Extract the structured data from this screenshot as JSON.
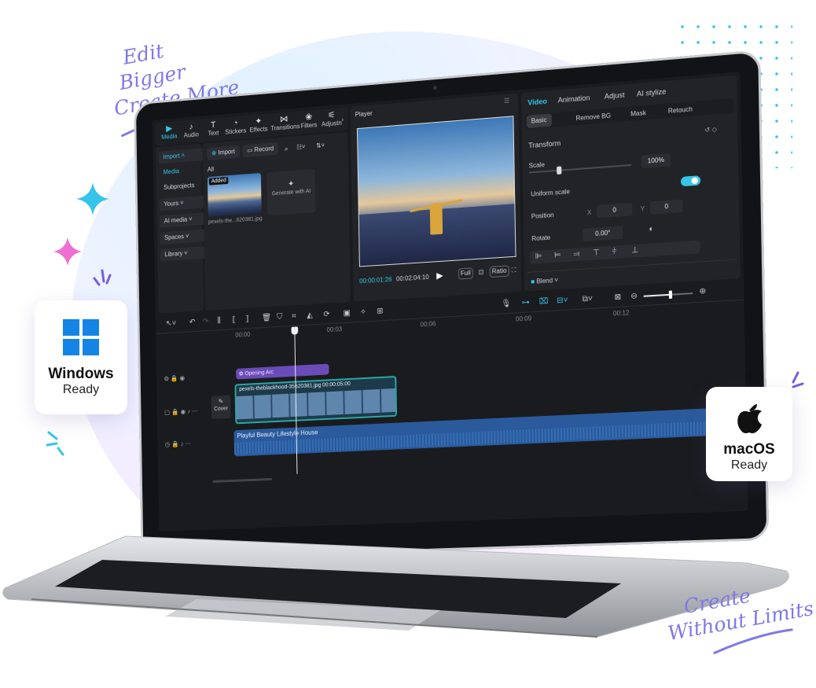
{
  "slogans": {
    "top": [
      "Edit",
      "Bigger",
      "Create More"
    ],
    "bottom": [
      "Create",
      "Without Limits"
    ]
  },
  "badges": {
    "windows": {
      "title": "Windows",
      "subtitle": "Ready"
    },
    "macos": {
      "title": "macOS",
      "subtitle": "Ready"
    }
  },
  "colors": {
    "accent": "#36c6e8",
    "slogan": "#7f78e6",
    "clip_purple": "#6b4bb8",
    "video_teal": "#2aa6a6"
  },
  "toolbar": [
    {
      "label": "Media",
      "icon": "media-icon"
    },
    {
      "label": "Audio",
      "icon": "audio-icon"
    },
    {
      "label": "Text",
      "icon": "text-icon"
    },
    {
      "label": "Stickers",
      "icon": "stickers-icon"
    },
    {
      "label": "Effects",
      "icon": "effects-icon"
    },
    {
      "label": "Transitions",
      "icon": "transitions-icon"
    },
    {
      "label": "Filters",
      "icon": "filters-icon"
    },
    {
      "label": "Adjustn",
      "icon": "adjustment-icon"
    }
  ],
  "sidebar": {
    "items": [
      "Import",
      "Media",
      "Subprojects",
      "Yours",
      "AI media",
      "Spaces",
      "Library"
    ]
  },
  "media": {
    "import_label": "Import",
    "record_label": "Record",
    "filter_label": "All",
    "thumb_badge": "Added",
    "thumb_name": "pexels-the...620381.jpg",
    "generate_label": "Generate with AI"
  },
  "player": {
    "title": "Player",
    "current_time": "00:00:01:26",
    "total_time": "00:02:04:10",
    "full_label": "Full",
    "ratio_label": "Ratio"
  },
  "inspector": {
    "tabs": [
      "Video",
      "Animation",
      "Adjust",
      "AI stylize"
    ],
    "subtabs": [
      "Basic",
      "Remove BG",
      "Mask",
      "Retouch"
    ],
    "transform_label": "Transform",
    "scale_label": "Scale",
    "scale_value": "100%",
    "scale_level": 0.3,
    "uniform_label": "Uniform scale",
    "position_label": "Position",
    "pos_x_label": "X",
    "pos_x": "0",
    "pos_y_label": "Y",
    "pos_y": "0",
    "rotate_label": "Rotate",
    "rotate_value": "0.00°",
    "blend_label": "Blend"
  },
  "timeline": {
    "ruler": [
      "00:00",
      "00:03",
      "00:06",
      "00:09",
      "00:12"
    ],
    "effect_clip": "Opening Arc",
    "video_clip": "pexels-theblackhood-35620381.jpg  00:00:05:00",
    "cover_label": "Cover",
    "audio_clip": "Playful Beauty Lifestyle House",
    "zoom_level": 0.55
  }
}
